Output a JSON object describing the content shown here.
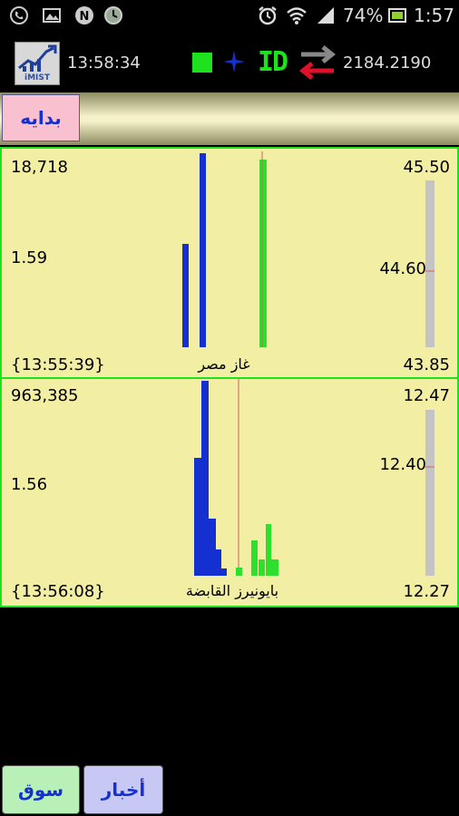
{
  "status_bar": {
    "icons": [
      "viber-icon",
      "gallery-icon",
      "n-icon",
      "clock-app-icon"
    ],
    "battery_percent": "74%",
    "time": "1:57",
    "right_icons": [
      "alarm-icon",
      "wifi-icon",
      "signal-icon",
      "battery-icon"
    ]
  },
  "header": {
    "logo_text": "iMIST",
    "time": "13:58:34",
    "id_label": "ID",
    "index_value": "2184.2190",
    "colors": {
      "green": "#1ee21e",
      "blue": "#1530d0",
      "red": "#e0102a",
      "grey": "#888888"
    }
  },
  "nav": {
    "start_label": "بدايه"
  },
  "panels": [
    {
      "volume": "18,718",
      "ratio": "1.59",
      "timestamp": "{13:55:39}",
      "name": "غاز مصر",
      "price_high": "45.50",
      "price_mid": "44.60",
      "price_low": "43.85"
    },
    {
      "volume": "963,385",
      "ratio": "1.56",
      "timestamp": "{13:56:08}",
      "name": "بايونيرز القابضة",
      "price_high": "12.47",
      "price_mid": "12.40",
      "price_low": "12.27"
    }
  ],
  "bottom": {
    "market_label": "سوق",
    "news_label": "أخبار"
  }
}
